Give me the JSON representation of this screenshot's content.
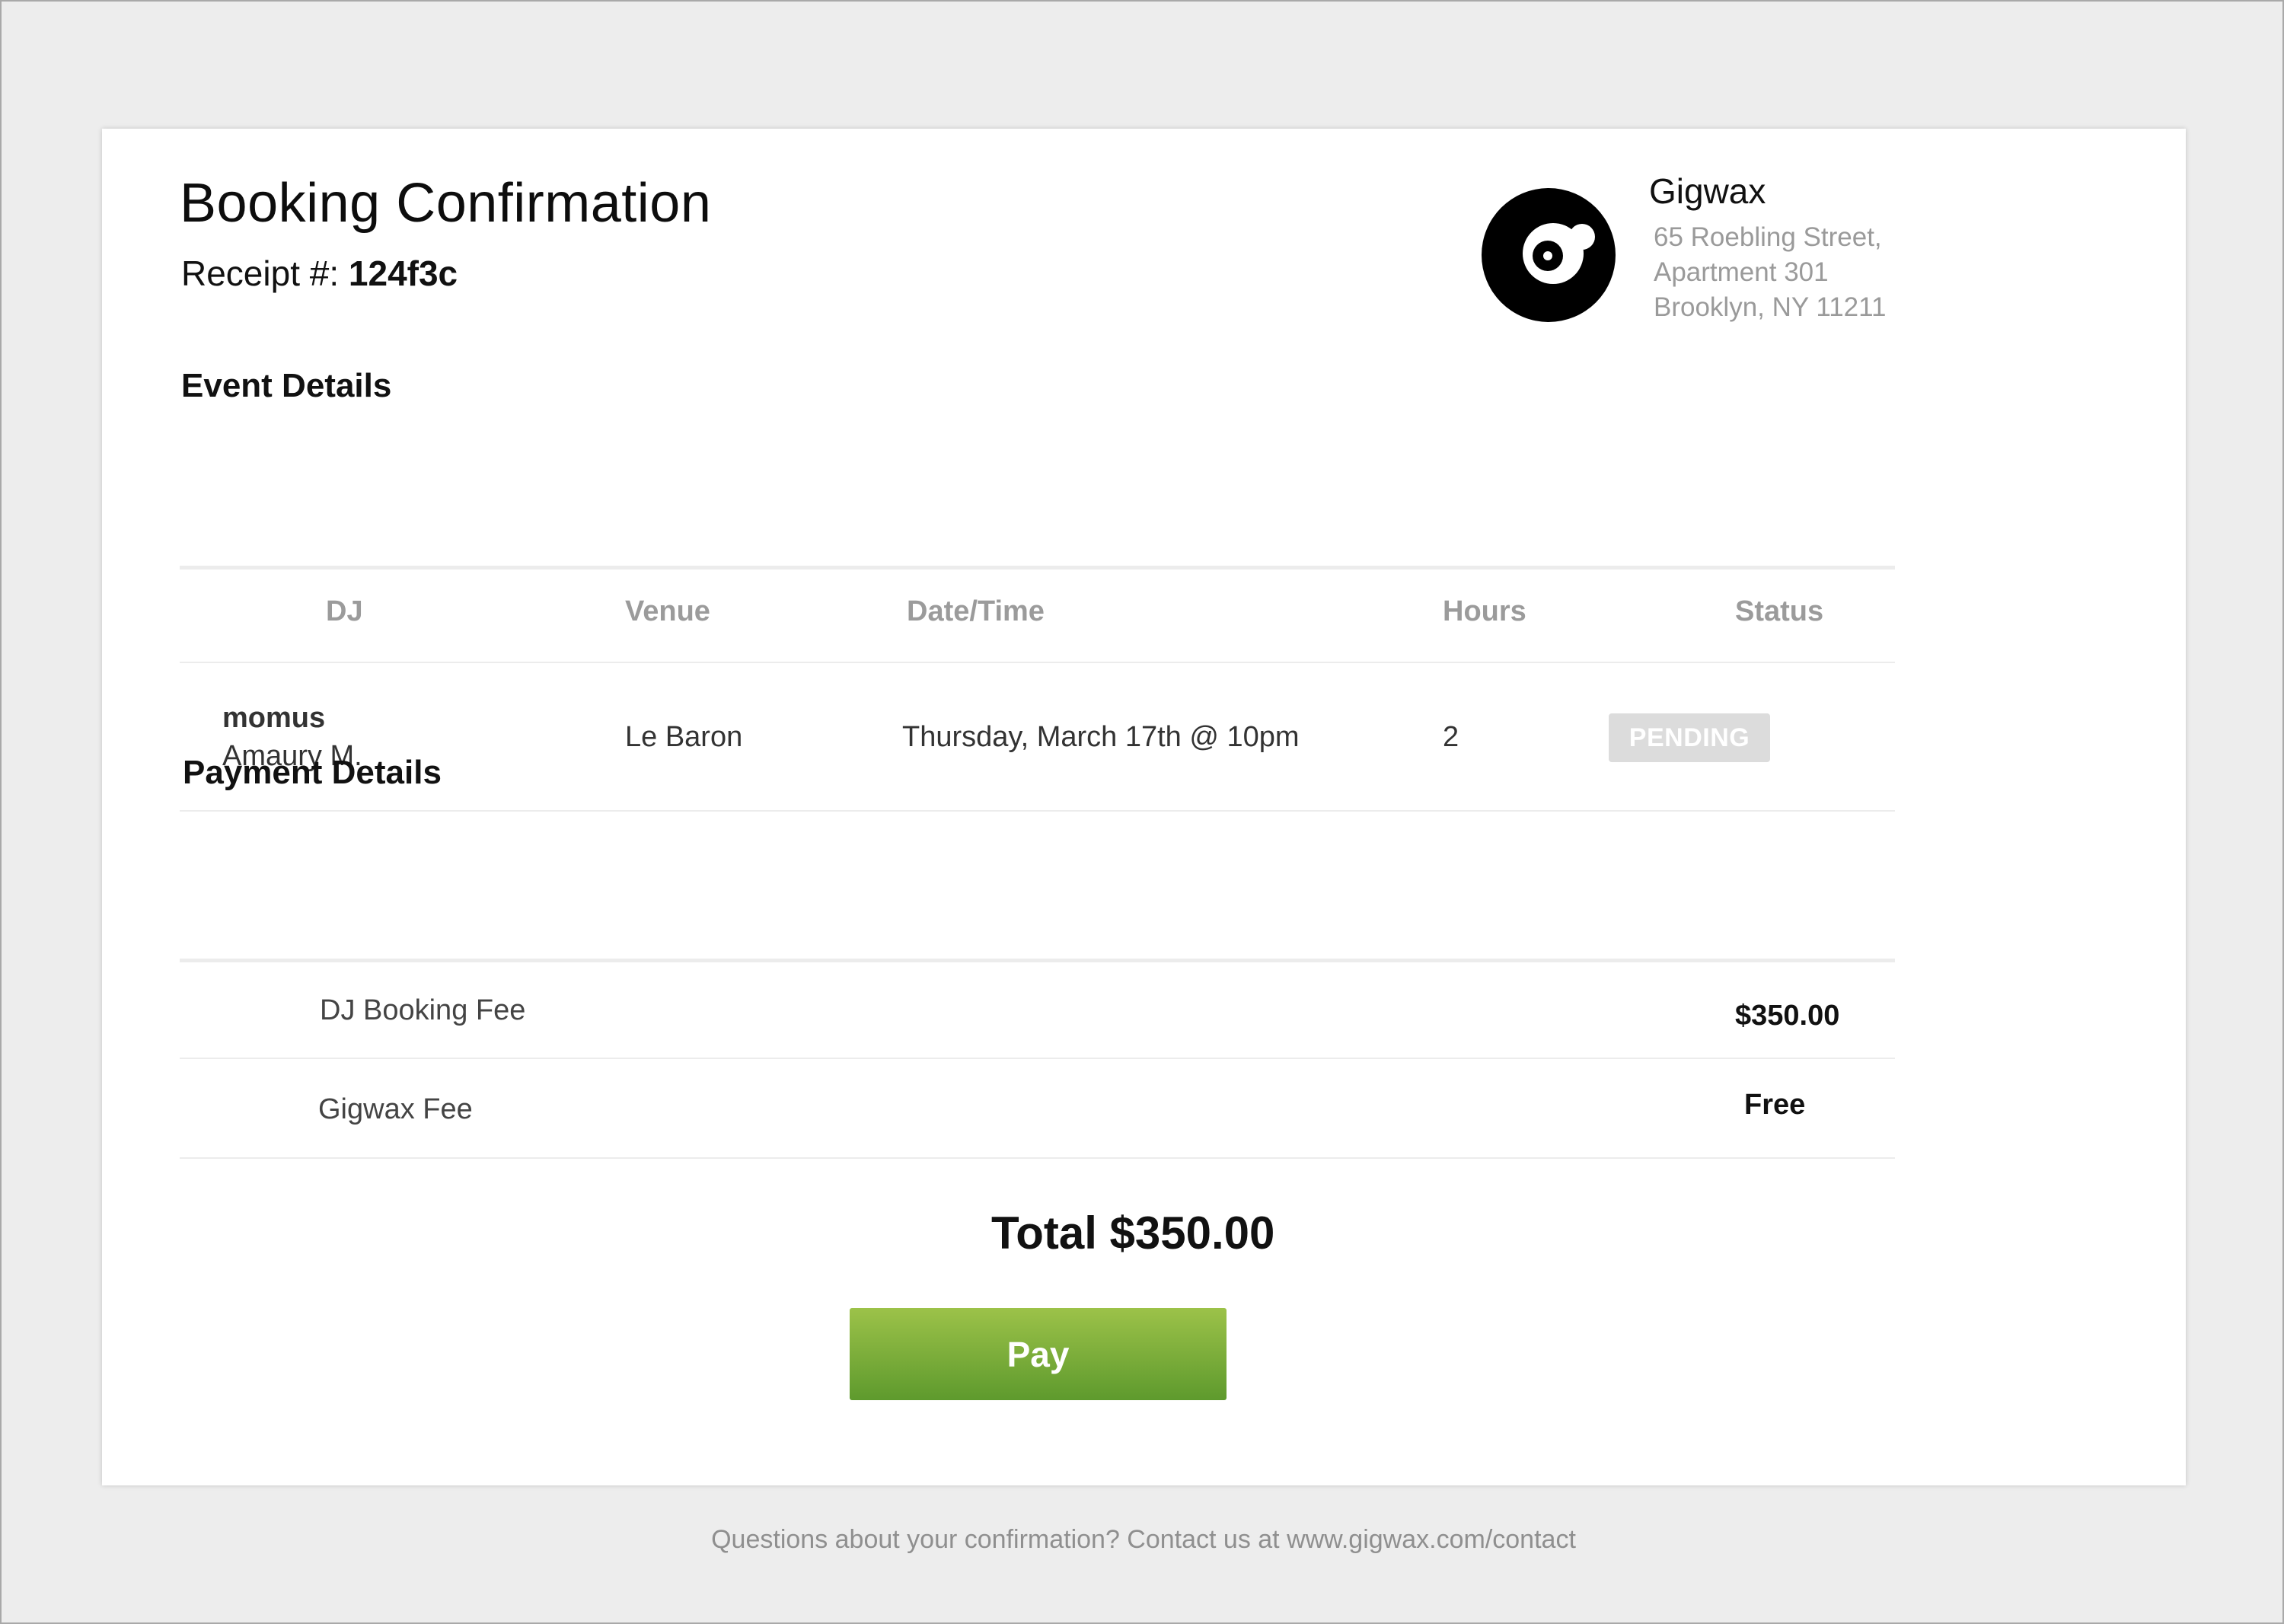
{
  "header": {
    "title": "Booking Confirmation",
    "receipt_label": "Receipt #:",
    "receipt_number": "124f3c"
  },
  "company": {
    "name": "Gigwax",
    "address_line1": "65 Roebling Street,",
    "address_line2": "Apartment 301",
    "address_line3": "Brooklyn, NY 11211",
    "logo_icon": "vinyl-record-icon"
  },
  "event_details": {
    "title": "Event Details",
    "columns": [
      "DJ",
      "Venue",
      "Date/Time",
      "Hours",
      "Status"
    ],
    "row": {
      "dj_handle": "momus",
      "dj_name": "Amaury M.",
      "venue": "Le Baron",
      "datetime": "Thursday, March 17th @ 10pm",
      "hours": "2",
      "status": "PENDING"
    }
  },
  "payment_details": {
    "title": "Payment Details",
    "items": [
      {
        "label": "DJ Booking Fee",
        "amount": "$350.00"
      },
      {
        "label": "Gigwax Fee",
        "amount": "Free"
      }
    ],
    "total": "Total $350.00",
    "pay_label": "Pay"
  },
  "footer": {
    "text": "Questions about your confirmation? Contact us at www.gigwax.com/contact"
  },
  "colors": {
    "background": "#ededed",
    "card": "#ffffff",
    "pay_button_top": "#9cc249",
    "pay_button_bottom": "#5e9a2d",
    "status_badge": "#dcdcdc",
    "muted_text": "#9b9b9b"
  }
}
